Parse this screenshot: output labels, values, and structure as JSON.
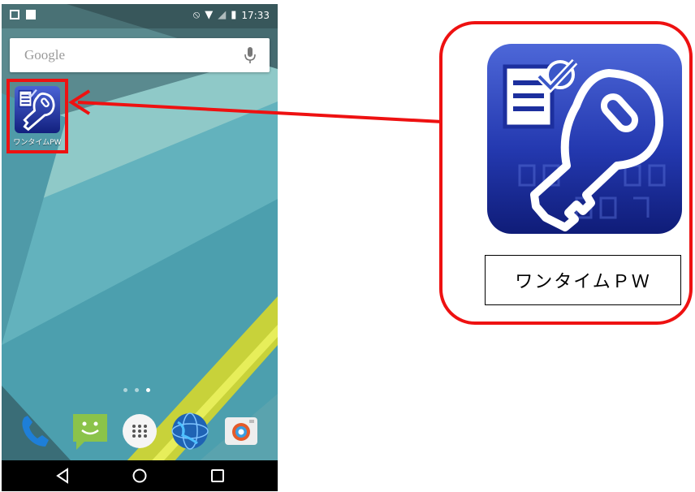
{
  "statusbar": {
    "time": "17:33",
    "icons": [
      "image-icon",
      "bag-icon",
      "do-not-disturb-icon",
      "wifi-icon",
      "signal-icon",
      "battery-icon"
    ]
  },
  "search": {
    "brand": "Google",
    "icon": "mic-icon"
  },
  "home": {
    "app": {
      "label": "ワンタイムPW",
      "icon": "key-document-icon"
    },
    "page_dots": 3,
    "active_page": 2,
    "dock": [
      {
        "name": "phone",
        "icon": "phone-icon"
      },
      {
        "name": "messages",
        "icon": "message-smile-icon"
      },
      {
        "name": "app-drawer",
        "icon": "grid-dots-icon"
      },
      {
        "name": "browser",
        "icon": "globe-icon"
      },
      {
        "name": "camera",
        "icon": "camera-icon"
      }
    ],
    "nav": [
      "back-icon",
      "home-icon",
      "recents-icon"
    ]
  },
  "callout": {
    "label": "ワンタイムＰＷ",
    "icon": "key-document-icon"
  },
  "colors": {
    "highlight": "#ee1111",
    "icon_blue": "#1c2f9e",
    "wallpaper": "#5fa7b3"
  }
}
